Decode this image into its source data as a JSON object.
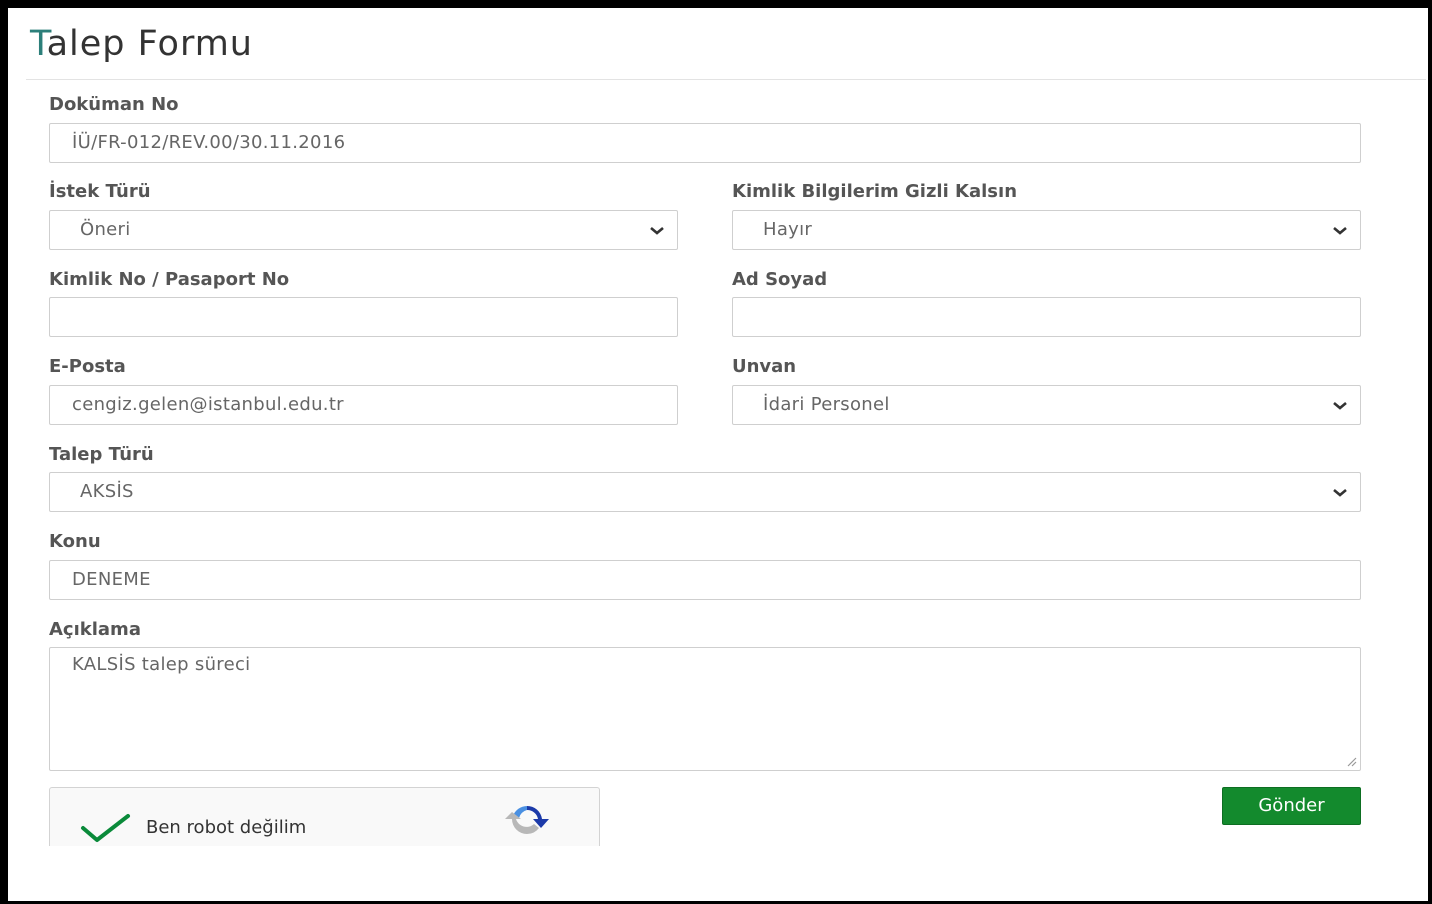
{
  "form": {
    "title_first": "T",
    "title_rest": "alep Formu",
    "document_no": {
      "label": "Doküman No",
      "value": "İÜ/FR-012/REV.00/30.11.2016"
    },
    "request_type": {
      "label": "İstek Türü",
      "value": "Öneri"
    },
    "identity_hidden": {
      "label": "Kimlik Bilgilerim Gizli Kalsın",
      "value": "Hayır"
    },
    "id_passport": {
      "label": "Kimlik No / Pasaport No",
      "value": ""
    },
    "full_name": {
      "label": "Ad Soyad",
      "value": ""
    },
    "email": {
      "label": "E-Posta",
      "value": "cengiz.gelen@istanbul.edu.tr"
    },
    "title_field": {
      "label": "Unvan",
      "value": "İdari Personel"
    },
    "demand_type": {
      "label": "Talep Türü",
      "value": "AKSİS"
    },
    "subject": {
      "label": "Konu",
      "value": "DENEME"
    },
    "description": {
      "label": "Açıklama",
      "value": "KALSİS talep süreci"
    },
    "captcha": {
      "label": "Ben robot değilim",
      "checked": true,
      "icon": "recaptcha-logo-icon"
    },
    "submit_label": "Gönder"
  },
  "colors": {
    "accent": "#2c7f7a",
    "submit": "#138a2d",
    "check": "#0a8a3a"
  }
}
